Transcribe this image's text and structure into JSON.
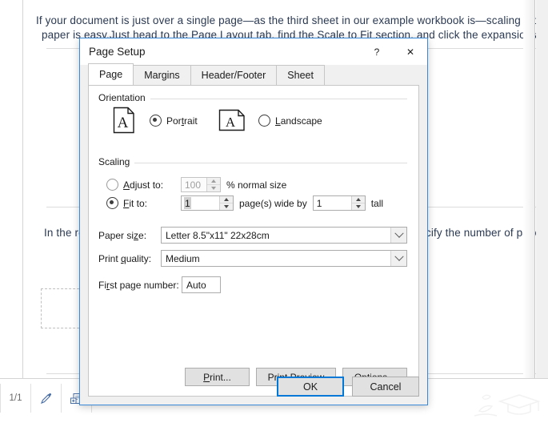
{
  "background_document": {
    "lines": [
      "If your document is just over a single page—as the third sheet in our example workbook is—scaling it down so",
      "paper is easy.Just head to the Page Layout tab, find the Scale to Fit section, and click the expansion arrow in th",
      "In the res                                                                                                     cify the number of pages y"
    ],
    "line1": "If your document is just over a single page—as the third sheet in our example workbook is—scaling it down so",
    "line2": "paper is easy.Just head to the Page Layout tab, find the Scale to Fit section, and click the expansion arrow in th",
    "line3_left": "In the res",
    "line3_right": "cify the number of pages y"
  },
  "status_bar": {
    "page_indicator": "1/1",
    "icons": [
      {
        "name": "pen-icon"
      },
      {
        "name": "add-sheet-icon"
      }
    ]
  },
  "dialog": {
    "title": "Page Setup",
    "titlebar_buttons": {
      "help": "?",
      "close": "✕"
    },
    "tabs": [
      {
        "label": "Page",
        "active": true
      },
      {
        "label": "Margins",
        "active": false
      },
      {
        "label": "Header/Footer",
        "active": false
      },
      {
        "label": "Sheet",
        "active": false
      }
    ],
    "orientation": {
      "group_label": "Orientation",
      "portrait": {
        "label": "Portrait",
        "accel": "t",
        "selected": true,
        "icon": "portrait-page-icon",
        "glyph": "A"
      },
      "landscape": {
        "label": "Landscape",
        "accel": "L",
        "selected": false,
        "icon": "landscape-page-icon",
        "glyph": "A"
      }
    },
    "scaling": {
      "group_label": "Scaling",
      "adjust_to": {
        "label": "Adjust to:",
        "accel": "A",
        "selected": false,
        "disabled": true,
        "value": "100",
        "suffix": "% normal size"
      },
      "fit_to": {
        "label": "Fit to:",
        "accel": "F",
        "selected": true,
        "disabled": false,
        "width_value": "1",
        "middle_text": "page(s) wide by",
        "height_value": "1",
        "suffix": "tall"
      }
    },
    "paper_size": {
      "label": "Paper size:",
      "accel": "z",
      "value": "Letter 8.5\"x11\" 22x28cm"
    },
    "print_quality": {
      "label": "Print quality:",
      "accel": "q",
      "value": "Medium"
    },
    "first_page_number": {
      "label": "First page number:",
      "accel": "r",
      "value": "Auto"
    },
    "buttons": {
      "print": "Print...",
      "print_preview": "Print Preview",
      "options": "Options...",
      "ok": "OK",
      "cancel": "Cancel"
    },
    "colors": {
      "focus_border": "#0078d7",
      "dialog_border": "#3b8ad9",
      "dialog_face": "#f0f0f0",
      "body_face": "#ffffff",
      "text": "#1b1b1b",
      "disabled_text": "#a0a0a0",
      "doc_text": "#2b3a53"
    }
  }
}
